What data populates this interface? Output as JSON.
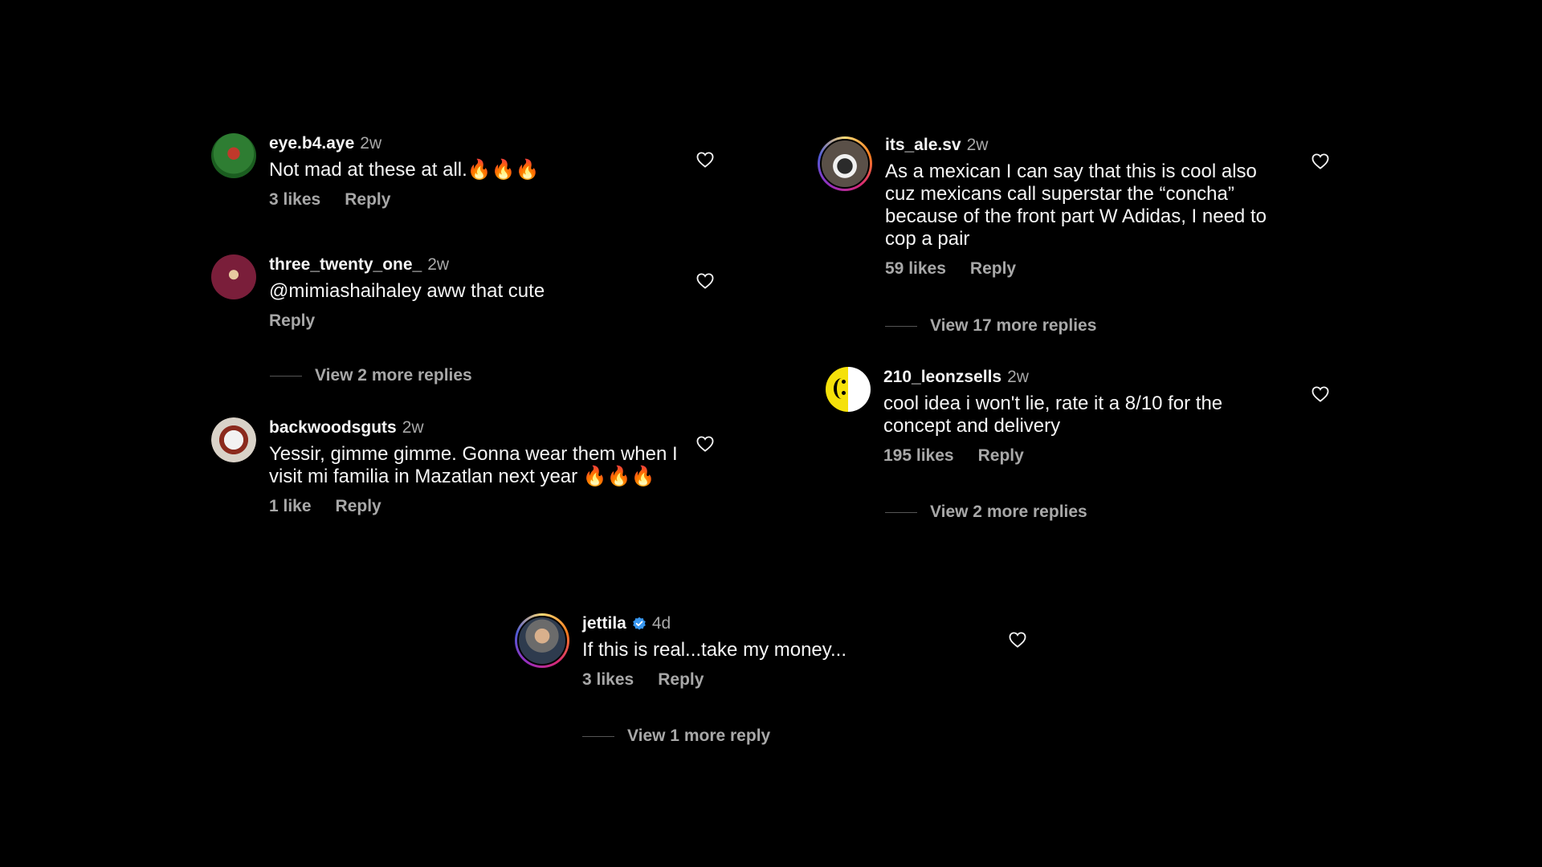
{
  "comments": [
    {
      "username": "eye.b4.aye",
      "time": "2w",
      "text": "Not mad at these at all.🔥🔥🔥",
      "likes": "3 likes",
      "reply": "Reply"
    },
    {
      "username": "three_twenty_one_",
      "time": "2w",
      "text": "@mimiashaihaley aww that cute",
      "reply": "Reply",
      "more_replies": "View 2 more replies"
    },
    {
      "username": "backwoodsguts",
      "time": "2w",
      "text": "Yessir, gimme gimme. Gonna wear them when I visit mi familia in Mazatlan next year 🔥🔥🔥",
      "likes": "1 like",
      "reply": "Reply"
    },
    {
      "username": "its_ale.sv",
      "time": "2w",
      "text": "As a mexican I can say that this is cool also cuz mexicans call superstar the “concha” because of the front part W Adidas, I need to cop a pair",
      "likes": "59 likes",
      "reply": "Reply",
      "more_replies": "View 17 more replies"
    },
    {
      "username": "210_leonzsells",
      "time": "2w",
      "text": "cool idea i won't lie, rate it a 8/10 for the concept and delivery",
      "likes": "195 likes",
      "reply": "Reply",
      "more_replies": "View 2 more replies"
    },
    {
      "username": "jettila",
      "time": "4d",
      "text": "If this is real...take my money...",
      "likes": "3 likes",
      "reply": "Reply",
      "more_replies": "View 1 more reply",
      "verified_icon": "verified-badge-icon"
    }
  ],
  "colors": {
    "background": "#000000",
    "text": "#f5f5f5",
    "muted": "#a8a8a8",
    "verified": "#3897f0"
  }
}
